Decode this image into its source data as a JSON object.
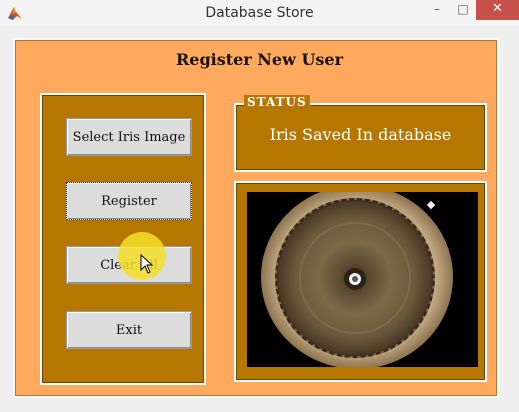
{
  "window": {
    "title": "Database Store",
    "minimize": "–",
    "maximize": "□",
    "close": "✕"
  },
  "panel": {
    "title": "Register New User"
  },
  "buttons": {
    "select_iris": "Select Iris Image",
    "register": "Register",
    "clear": "Clear All",
    "exit": "Exit"
  },
  "status": {
    "legend": "STATUS",
    "message": "Iris Saved In database"
  },
  "icons": {
    "app": "matlab-icon",
    "cursor": "mouse-pointer-icon"
  },
  "colors": {
    "panel": "#ffa95f",
    "group": "#b57700",
    "close": "#c7504b"
  }
}
